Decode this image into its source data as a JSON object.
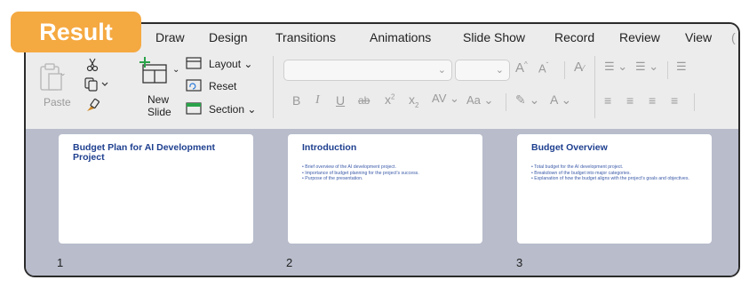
{
  "badge": {
    "label": "Result"
  },
  "tabs": [
    "Draw",
    "Design",
    "Transitions",
    "Animations",
    "Slide Show",
    "Record",
    "Review",
    "View"
  ],
  "ribbon": {
    "paste_label": "Paste",
    "new_slide_label_1": "New",
    "new_slide_label_2": "Slide",
    "layout_label": "Layout",
    "reset_label": "Reset",
    "section_label": "Section"
  },
  "slides": [
    {
      "number": "1",
      "title": "Budget Plan for AI Development Project",
      "bullets": []
    },
    {
      "number": "2",
      "title": "Introduction",
      "bullets": [
        "• Brief overview of the AI development project.",
        "• Importance of budget planning for the project's success.",
        "• Purpose of the presentation."
      ]
    },
    {
      "number": "3",
      "title": "Budget Overview",
      "bullets": [
        "• Total budget for the AI development project.",
        "• Breakdown of the budget into major categories.",
        "• Explanation of how the budget aligns with the project's goals and objectives."
      ]
    }
  ],
  "colors": {
    "badge": "#f5a941",
    "slide_title": "#1e3f8f",
    "slide_area": "#b8bccb"
  }
}
